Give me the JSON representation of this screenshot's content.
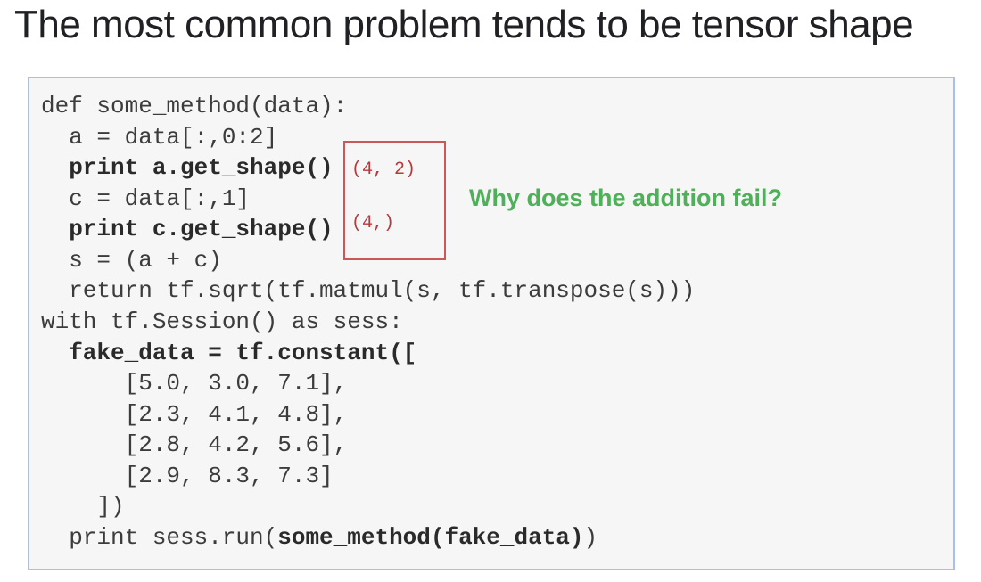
{
  "slide": {
    "title": "The most common problem tends to be tensor shape",
    "question": "Why does the addition fail?",
    "annotations": {
      "shape_a": "(4, 2)",
      "shape_c": "(4,)"
    },
    "code": {
      "l1": "def some_method(data):",
      "l2": "  a = data[:,0:2]",
      "l3": "  print a.get_shape()",
      "l4": "  c = data[:,1]",
      "l5": "  print c.get_shape()",
      "l6": "  s = (a + c)",
      "l7": "  return tf.sqrt(tf.matmul(s, tf.transpose(s)))",
      "l8": "with tf.Session() as sess:",
      "l9": "  fake_data = tf.constant([",
      "l10": "      [5.0, 3.0, 7.1],",
      "l11": "      [2.3, 4.1, 4.8],",
      "l12": "      [2.8, 4.2, 5.6],",
      "l13": "      [2.9, 8.3, 7.3]",
      "l14": "    ])",
      "l15_prefix": "  print sess.run(",
      "l15_call": "some_method(fake_data)",
      "l15_suffix": ")"
    }
  }
}
